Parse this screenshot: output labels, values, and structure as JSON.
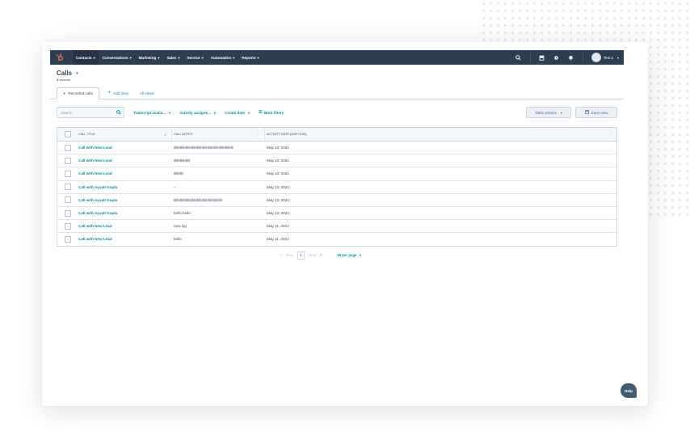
{
  "nav": {
    "items": [
      {
        "label": "Contacts",
        "active": true
      },
      {
        "label": "Conversations",
        "active": false
      },
      {
        "label": "Marketing",
        "active": false
      },
      {
        "label": "Sales",
        "active": false
      },
      {
        "label": "Service",
        "active": false
      },
      {
        "label": "Automation",
        "active": false
      },
      {
        "label": "Reports",
        "active": false
      }
    ],
    "account": "Test 2",
    "icons": [
      "search-icon",
      "marketplace-icon",
      "settings-icon",
      "notifications-icon"
    ],
    "brand_color": "#ff7a59",
    "bar_color": "#2d3e50"
  },
  "header": {
    "title": "Calls",
    "record_count": "8 records"
  },
  "tabs": {
    "recorded": "Recorded calls",
    "add_view": "Add view",
    "all_views": "All views"
  },
  "filters": {
    "search_placeholder": "Search",
    "transcript": "Transcript availa...",
    "activity_assignee": "Activity assigne...",
    "create_date": "Create date",
    "more_filters": "More filters",
    "table_actions": "Table actions",
    "save_view": "Save view"
  },
  "table": {
    "columns": [
      "CALL TITLE",
      "CALL NOTES",
      "ACTIVITY DATE (GMT+5:30)"
    ],
    "rows": [
      {
        "title": "Call with New Lead",
        "notes": "",
        "date": "May 13, 2021"
      },
      {
        "title": "Call with New Lead",
        "notes": "",
        "date": "May 13, 2021"
      },
      {
        "title": "Call with New Lead",
        "notes": "",
        "date": "May 13, 2021"
      },
      {
        "title": "Call with Ayush Gupta",
        "notes": "--",
        "date": "May 13, 2021"
      },
      {
        "title": "Call with Ayush Gupta",
        "notes": "",
        "date": "May 13, 2021"
      },
      {
        "title": "Call with Ayush Gupta",
        "notes": "hello hello",
        "date": "May 13, 2021"
      },
      {
        "title": "Call with New Lead",
        "notes": "new log",
        "date": "May 11, 2021"
      },
      {
        "title": "Call with New Lead",
        "notes": "hello",
        "date": "May 11, 2021"
      }
    ]
  },
  "pager": {
    "prev": "Prev",
    "page": "1",
    "next": "Next",
    "per_page": "25 per page"
  },
  "help": "Help"
}
